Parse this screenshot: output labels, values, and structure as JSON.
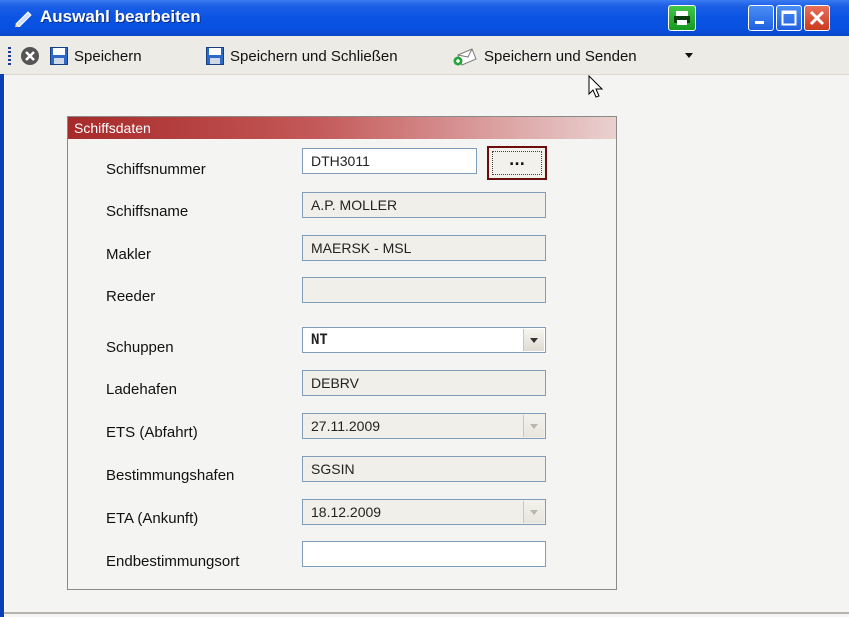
{
  "window": {
    "title": "Auswahl bearbeiten"
  },
  "toolbar": {
    "save_label": "Speichern",
    "save_close_label": "Speichern und Schließen",
    "save_send_label": "Speichern und Senden"
  },
  "group": {
    "title": "Schiffsdaten"
  },
  "form": {
    "schiffsnummer": {
      "label": "Schiffsnummer",
      "value": "DTH3011",
      "browse_label": "..."
    },
    "schiffsname": {
      "label": "Schiffsname",
      "value": "A.P. MOLLER"
    },
    "makler": {
      "label": "Makler",
      "value": "MAERSK - MSL"
    },
    "reeder": {
      "label": "Reeder",
      "value": ""
    },
    "schuppen": {
      "label": "Schuppen",
      "value": "NT"
    },
    "ladehafen": {
      "label": "Ladehafen",
      "value": "DEBRV"
    },
    "ets": {
      "label": "ETS (Abfahrt)",
      "value": "27.11.2009"
    },
    "bestimmungshafen": {
      "label": "Bestimmungshafen",
      "value": "SGSIN"
    },
    "eta": {
      "label": "ETA (Ankunft)",
      "value": "18.12.2009"
    },
    "endbestimmungsort": {
      "label": "Endbestimmungsort",
      "value": ""
    }
  },
  "icons": {
    "title": "edit-pencil-icon",
    "printer": "printer-icon",
    "minimize": "minimize-icon",
    "maximize": "maximize-icon",
    "close": "close-icon",
    "cancel": "cancel-circle-icon",
    "save": "floppy-disk-icon",
    "send": "envelope-send-icon",
    "dropdown": "chevron-down-icon"
  },
  "colors": {
    "titlebar": "#0a54e3",
    "group_header": "#a72a2a",
    "accent_green": "#159a22"
  }
}
